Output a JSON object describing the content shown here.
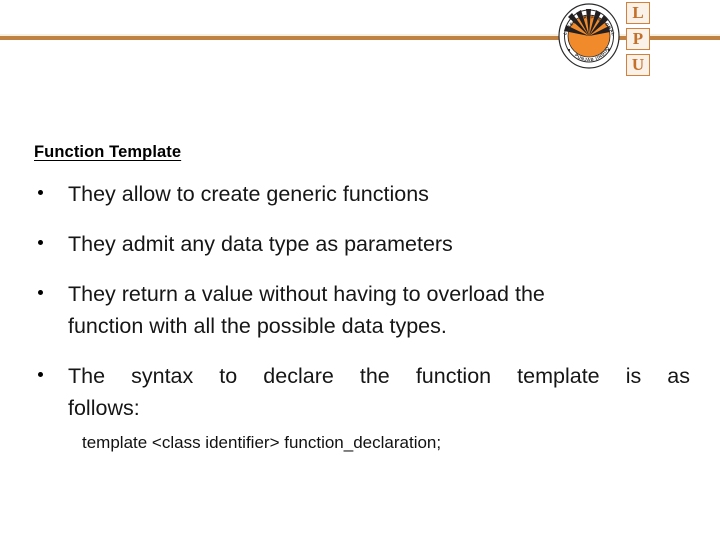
{
  "slide": {
    "background_color": "#ffffff",
    "accent_color": "#c08243"
  },
  "header": {
    "rule_color": "#c08243",
    "logo": {
      "emblem_outer_text_top": "LOVELY PROFESSIONAL UNIVERSITY",
      "emblem_outer_text_bottom": "PUNJAB (INDIA)",
      "letters": [
        "L",
        "P",
        "U"
      ],
      "emblem_colors": {
        "ray_orange": "#f08a2a",
        "ray_black": "#231f20",
        "ring": "#2b2b2b"
      }
    }
  },
  "content": {
    "heading": "Function Template",
    "bullets": [
      {
        "marker": "•",
        "lines": [
          "They allow to create generic functions"
        ],
        "justified": false
      },
      {
        "marker": "•",
        "lines": [
          "They admit any data type as parameters"
        ],
        "justified": false
      },
      {
        "marker": "•",
        "lines": [
          "They return a value without having to overload the",
          "function with all the possible data types."
        ],
        "justified": false
      },
      {
        "marker": "•",
        "lines": [
          "The syntax to declare the function template is as",
          "follows:"
        ],
        "justified": true
      }
    ],
    "code_line": "template <class identifier> function_declaration;"
  }
}
